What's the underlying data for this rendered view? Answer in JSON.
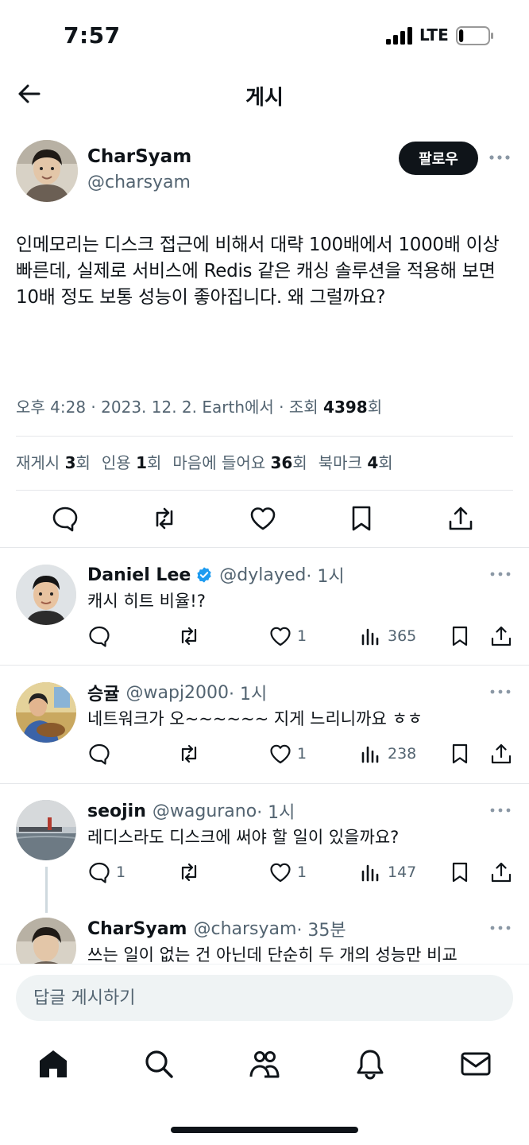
{
  "status_bar": {
    "time": "7:57",
    "network": "LTE",
    "battery_level": 0.15
  },
  "header": {
    "title": "게시"
  },
  "post": {
    "author_name": "CharSyam",
    "author_handle": "@charsyam",
    "follow_label": "팔로우",
    "body": "인메모리는 디스크 접근에 비해서 대략 100배에서 1000배 이상 빠른데, 실제로 서비스에 Redis 같은 캐싱 솔루션을 적용해 보면 10배 정도 보통 성능이 좋아집니다. 왜 그럴까요?",
    "meta": "오후 4:28 · 2023. 12. 2. Earth에서 · 조회 ",
    "views": "4398",
    "views_suffix": "회",
    "stats": {
      "reposts_label": "재게시 ",
      "reposts": "3",
      "reposts_suffix": "회",
      "quotes_label": "인용 ",
      "quotes": "1",
      "quotes_suffix": "회",
      "likes_label": "마음에 들어요 ",
      "likes": "36",
      "likes_suffix": "회",
      "bookmarks_label": "북마크 ",
      "bookmarks": "4",
      "bookmarks_suffix": "회"
    }
  },
  "replies": [
    {
      "name": "Daniel Lee",
      "handle": "@dylayed",
      "time": " · 1시",
      "text": "캐시 히트 비율!?",
      "replies": "",
      "likes": "1",
      "views": "365",
      "verified": true
    },
    {
      "name": "승귤",
      "handle": "@wapj2000",
      "time": " · 1시",
      "text": "네트워크가 오~~~~~~ 지게 느리니까요 ㅎㅎ",
      "replies": "",
      "likes": "1",
      "views": "238",
      "verified": false
    },
    {
      "name": "seojin",
      "handle": "@wagurano",
      "time": " · 1시",
      "text": "레디스라도 디스크에 써야 할 일이 있을까요?",
      "replies": "1",
      "likes": "1",
      "views": "147",
      "verified": false
    },
    {
      "name": "CharSyam",
      "handle": "@charsyam",
      "time": " · 35분",
      "text": "쓰는 일이 없는 건 아닌데 단순히 두 개의 성능만 비교",
      "verified": false
    }
  ],
  "composer": {
    "placeholder": "답글 게시하기"
  },
  "colors": {
    "accent": "#1d9bf0",
    "text": "#0f1419",
    "secondary": "#536471"
  }
}
